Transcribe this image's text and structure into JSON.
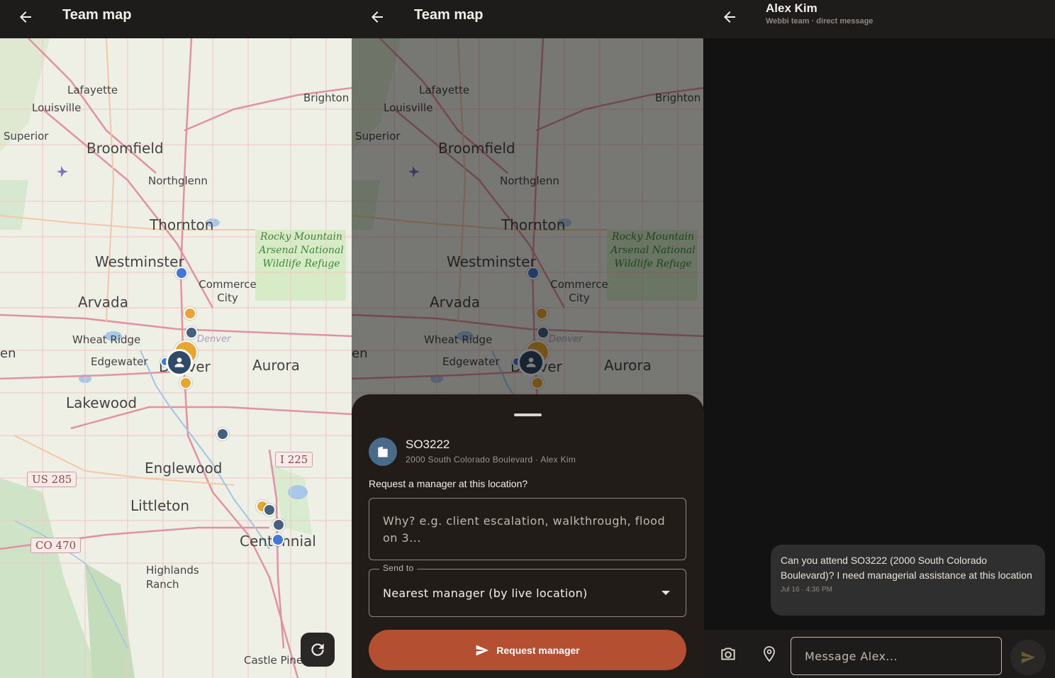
{
  "map_screen": {
    "title": "Team map",
    "back_icon": "arrow-left-icon",
    "refresh_icon": "refresh-icon",
    "labels": {
      "lafayette": "Lafayette",
      "louisville": "Louisville",
      "brighton": "Brighton",
      "superior": "Superior",
      "broomfield": "Broomfield",
      "northglenn": "Northglenn",
      "thornton": "Thornton",
      "westminster": "Westminster",
      "commerce_city": "Commerce City",
      "arvada": "Arvada",
      "wheat_ridge": "Wheat Ridge",
      "denver_small": "Denver",
      "edgewater": "Edgewater",
      "denver": "Denver",
      "aurora": "Aurora",
      "lakewood": "Lakewood",
      "englewood": "Englewood",
      "littleton": "Littleton",
      "centennial": "Centennial",
      "highlands_ranch": "Highlands Ranch",
      "castle_pines": "Castle Pines",
      "refuge": "Rocky Mountain Arsenal National Wildlife Refuge",
      "us285": "US 285",
      "i225": "I 225",
      "co470": "CO 470",
      "edge_left": "en"
    },
    "colors": {
      "blue_dot": "#3f78d8",
      "gold_dot": "#e8a530",
      "slate_dot": "#46617f"
    }
  },
  "request_sheet": {
    "site_code": "SO3222",
    "site_sub": "2000 South Colorado Boulevard · Alex Kim",
    "site_icon": "building-icon",
    "question": "Request a manager at this location?",
    "reason_placeholder": "Why? e.g. client escalation, walkthrough, flood on 3...",
    "send_to_label": "Send to",
    "send_to_value": "Nearest manager (by live location)",
    "button_label": "Request manager",
    "button_icon": "send-icon",
    "accent": "#b54f32"
  },
  "chat_screen": {
    "name": "Alex Kim",
    "subtitle": "Webbi team · direct message",
    "message": "Can you attend SO3222 (2000 South Colorado Boulevard)? I need managerial assistance at this location",
    "timestamp": "Jul 16 · 4:36 PM",
    "input_placeholder": "Message Alex...",
    "camera_icon": "camera-icon",
    "location_icon": "location-pin-icon",
    "send_icon": "send-icon"
  }
}
